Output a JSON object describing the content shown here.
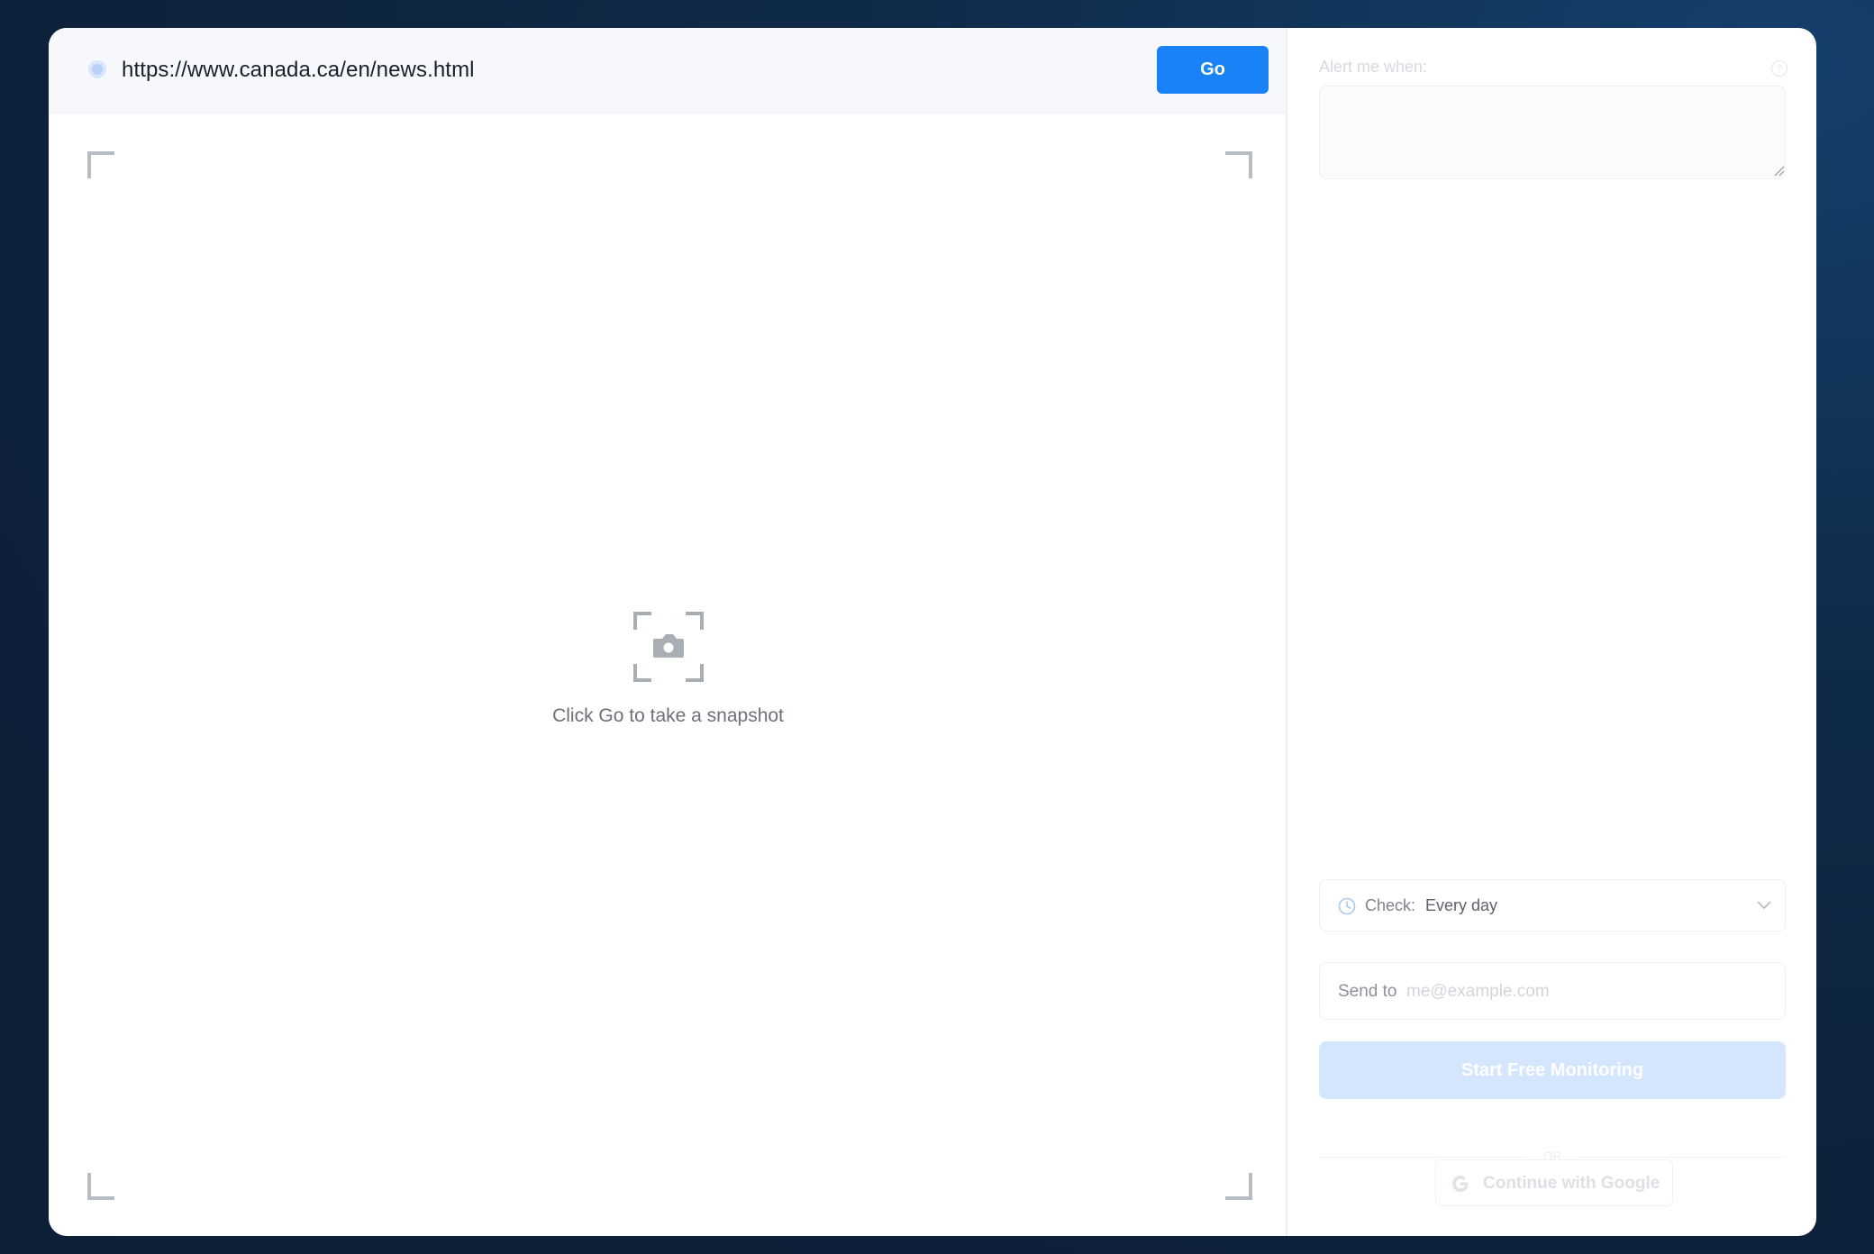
{
  "url_bar": {
    "url": "https://www.canada.ca/en/news.html",
    "go_label": "Go"
  },
  "preview": {
    "empty_message": "Click Go to take a snapshot",
    "icon": "camera-icon"
  },
  "alert": {
    "label": "Alert me when:",
    "help_glyph": "?",
    "text": ""
  },
  "check": {
    "label": "Check:",
    "value": "Every day",
    "icon": "clock-icon"
  },
  "send": {
    "label": "Send to",
    "placeholder": "me@example.com"
  },
  "start_button": {
    "label": "Start Free Monitoring"
  },
  "divider": {
    "text": "OR"
  },
  "google_button": {
    "label": "Continue with Google"
  },
  "colors": {
    "accent": "#1a82f7",
    "accent_disabled": "#d4e6fd",
    "background": "#0e213a"
  }
}
